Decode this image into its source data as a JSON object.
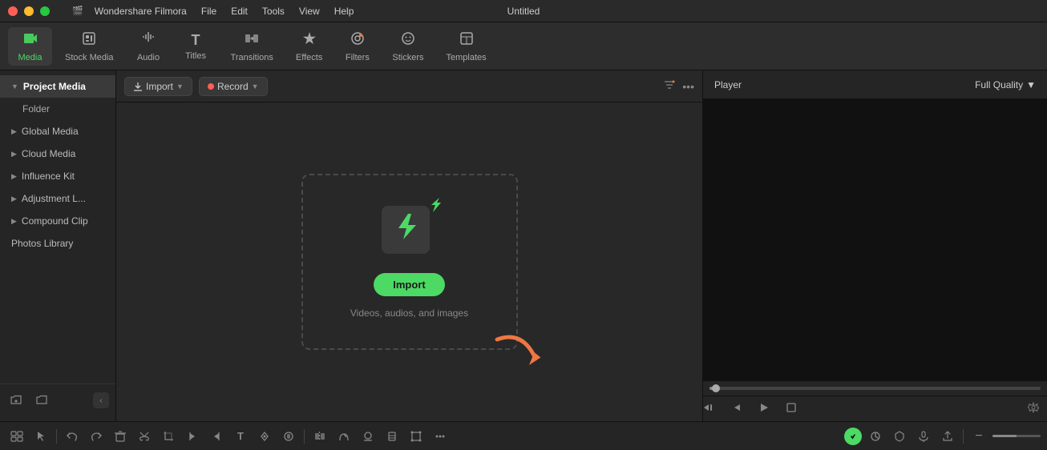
{
  "titlebar": {
    "app_name": "Wondershare Filmora",
    "window_title": "Untitled"
  },
  "menu": {
    "items": [
      "File",
      "Edit",
      "Tools",
      "View",
      "Help"
    ]
  },
  "toolbar": {
    "items": [
      {
        "id": "media",
        "label": "Media",
        "icon": "🎬",
        "active": true
      },
      {
        "id": "stock",
        "label": "Stock Media",
        "icon": "📦",
        "active": false
      },
      {
        "id": "audio",
        "label": "Audio",
        "icon": "🎵",
        "active": false
      },
      {
        "id": "titles",
        "label": "Titles",
        "icon": "T",
        "active": false
      },
      {
        "id": "transitions",
        "label": "Transitions",
        "icon": "↔",
        "active": false
      },
      {
        "id": "effects",
        "label": "Effects",
        "icon": "✦",
        "active": false
      },
      {
        "id": "filters",
        "label": "Filters",
        "icon": "◈",
        "active": false
      },
      {
        "id": "stickers",
        "label": "Stickers",
        "icon": "😊",
        "active": false
      },
      {
        "id": "templates",
        "label": "Templates",
        "icon": "⬜",
        "active": false
      }
    ]
  },
  "sidebar": {
    "items": [
      {
        "id": "project-media",
        "label": "Project Media",
        "indent": false,
        "bold": true,
        "arrow": true,
        "active": true
      },
      {
        "id": "folder",
        "label": "Folder",
        "indent": true,
        "bold": false,
        "arrow": false,
        "active": false
      },
      {
        "id": "global-media",
        "label": "Global Media",
        "indent": false,
        "bold": false,
        "arrow": true,
        "active": false
      },
      {
        "id": "cloud-media",
        "label": "Cloud Media",
        "indent": false,
        "bold": false,
        "arrow": true,
        "active": false
      },
      {
        "id": "influence-kit",
        "label": "Influence Kit",
        "indent": false,
        "bold": false,
        "arrow": true,
        "active": false
      },
      {
        "id": "adjustment-l",
        "label": "Adjustment L...",
        "indent": false,
        "bold": false,
        "arrow": true,
        "active": false
      },
      {
        "id": "compound-clip",
        "label": "Compound Clip",
        "indent": false,
        "bold": false,
        "arrow": true,
        "active": false
      },
      {
        "id": "photos-library",
        "label": "Photos Library",
        "indent": false,
        "bold": false,
        "arrow": false,
        "active": false
      }
    ]
  },
  "media_toolbar": {
    "import_label": "Import",
    "record_label": "Record"
  },
  "import_area": {
    "button_label": "Import",
    "drop_text": "Videos, audios, and images"
  },
  "preview": {
    "player_label": "Player",
    "quality_label": "Full Quality"
  },
  "bottom_toolbar": {
    "more_icon": "›",
    "items": [
      "⊞",
      "⟵",
      "⟶",
      "🗑",
      "✂",
      "⬜",
      "↺",
      "↻",
      "⊂⊃",
      "♩",
      "T",
      "↩",
      "↪",
      "◫",
      "≡",
      "⌚",
      "⟳",
      "⋮"
    ]
  }
}
